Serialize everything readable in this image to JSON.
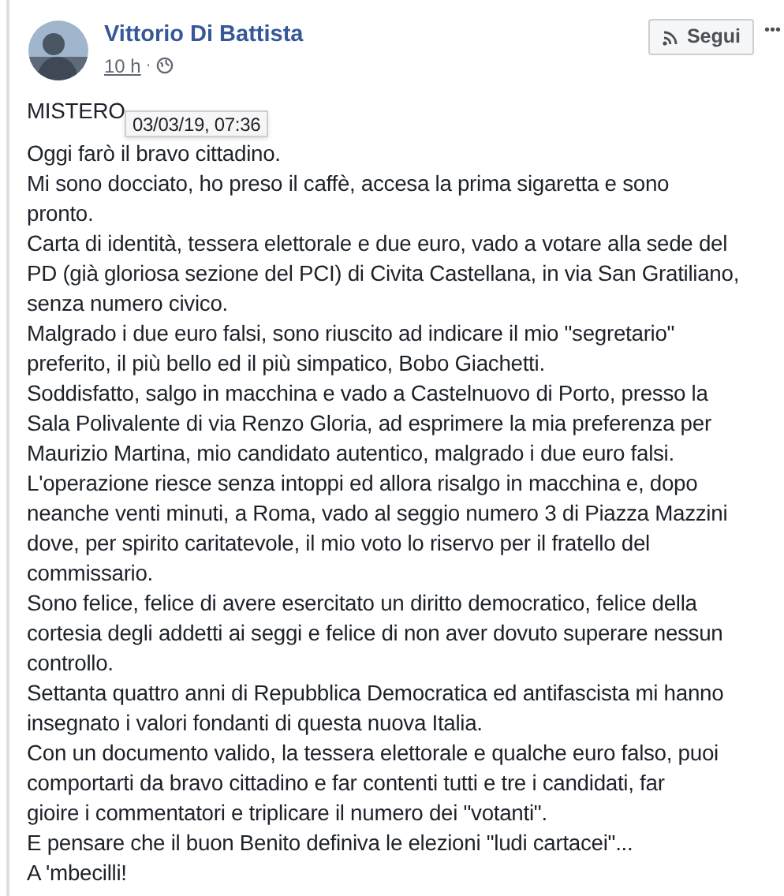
{
  "post": {
    "author": "Vittorio Di Battista",
    "time": "10 h",
    "separator": "·",
    "follow_button": "Segui",
    "more": "•••",
    "title": "MISTERO",
    "tooltip": "03/03/19, 07:36",
    "paragraphs": [
      {
        "lines": [
          "Oggi farò il bravo cittadino."
        ]
      },
      {
        "lines": [
          "Mi sono docciato, ho preso il caffè, accesa la prima sigaretta e sono",
          "pronto."
        ]
      },
      {
        "lines": [
          "Carta di identità, tessera elettorale e due euro, vado a votare alla sede del",
          "PD (già gloriosa sezione del PCI) di Civita Castellana, in via San Gratiliano,",
          "senza numero civico."
        ]
      },
      {
        "lines": [
          "Malgrado i due euro falsi, sono riuscito ad indicare il mio \"segretario\"",
          "preferito, il più bello ed il più simpatico, Bobo Giachetti."
        ]
      },
      {
        "lines": [
          "Soddisfatto, salgo in macchina e vado a Castelnuovo di Porto, presso la",
          "Sala Polivalente di via Renzo Gloria, ad esprimere la mia preferenza per",
          "Maurizio Martina, mio candidato autentico, malgrado i due euro falsi."
        ]
      },
      {
        "lines": [
          "L'operazione riesce senza intoppi ed allora risalgo in macchina e, dopo",
          "neanche venti minuti, a Roma, vado al seggio numero 3 di Piazza Mazzini",
          "dove, per spirito caritatevole, il mio voto lo riservo per il fratello del",
          "commissario."
        ]
      },
      {
        "lines": [
          "Sono felice, felice di avere esercitato un diritto democratico, felice della",
          "cortesia degli addetti ai seggi e felice di non aver dovuto superare nessun",
          "controllo."
        ]
      },
      {
        "lines": [
          "Settanta quattro anni di Repubblica Democratica ed antifascista mi hanno",
          "insegnato i valori fondanti di questa nuova Italia."
        ]
      },
      {
        "lines": [
          "Con un documento valido, la tessera elettorale e qualche euro falso, puoi",
          "comportarti da bravo cittadino e far contenti tutti e tre i candidati, far",
          "gioire i commentatori e triplicare il numero dei \"votanti\"."
        ]
      },
      {
        "lines": [
          "E pensare che il buon Benito definiva le elezioni \"ludi cartacei\"..."
        ]
      },
      {
        "lines": [
          "A 'mbecilli!"
        ]
      }
    ]
  }
}
